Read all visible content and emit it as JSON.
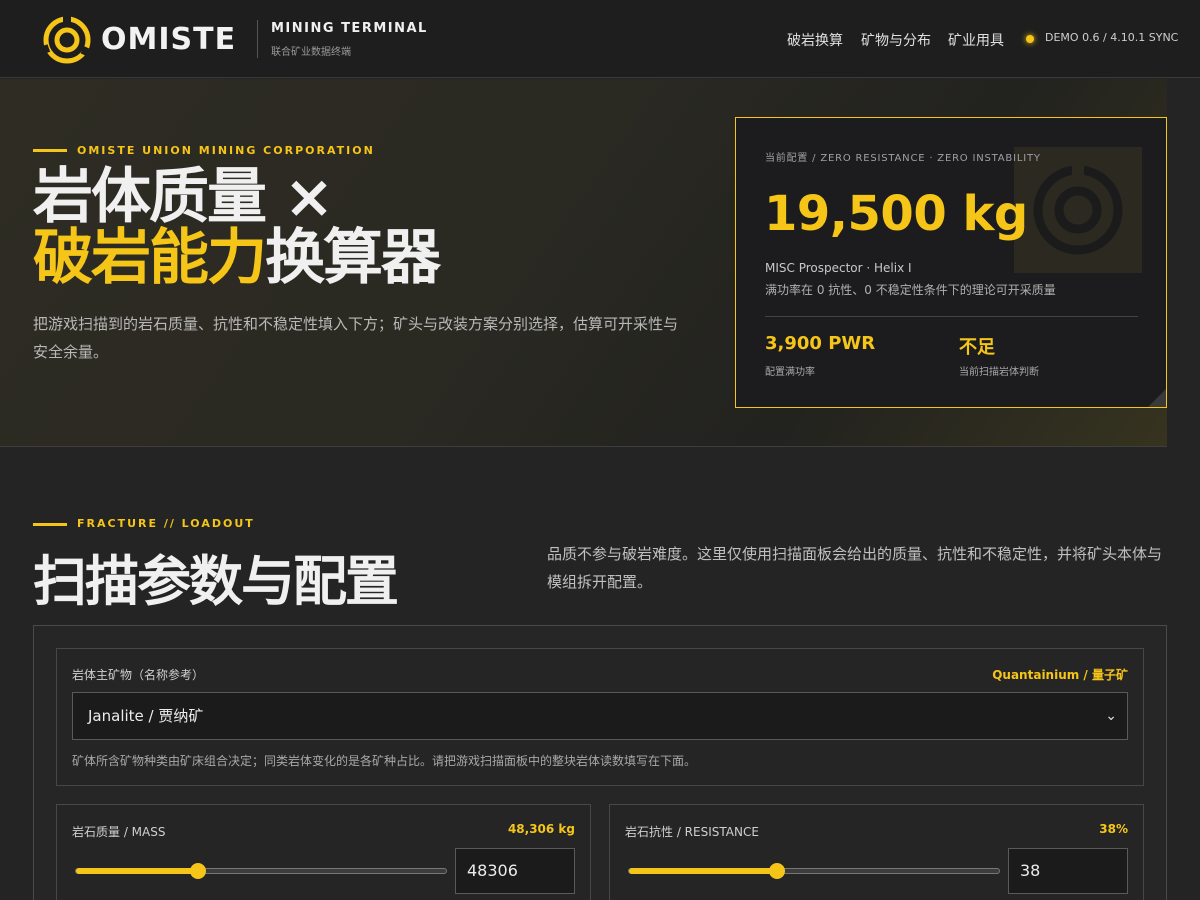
{
  "header": {
    "brand": "OMISTE",
    "subtitle": "MINING TERMINAL",
    "subtitle_cn": "联合矿业数据终端",
    "nav": [
      "破岩换算",
      "矿物与分布",
      "矿业用具"
    ],
    "status": "DEMO 0.6 / 4.10.1 SYNC"
  },
  "hero": {
    "eyebrow": "OMISTE UNION MINING CORPORATION",
    "title_line1": "岩体质量 ×",
    "title_line2_accent": "破岩能力",
    "title_line2_rest": "换算器",
    "description": "把游戏扫描到的岩石质量、抗性和不稳定性填入下方；矿头与改装方案分别选择，估算可开采性与安全余量。"
  },
  "result_card": {
    "label": "当前配置 / ZERO RESISTANCE · ZERO INSTABILITY",
    "value": "19,500 kg",
    "ship": "MISC Prospector · Helix I",
    "note": "满功率在 0 抗性、0 不稳定性条件下的理论可开采质量",
    "stats": [
      {
        "value": "3,900 PWR",
        "label": "配置满功率"
      },
      {
        "value": "不足",
        "label": "当前扫描岩体判断"
      }
    ]
  },
  "section": {
    "eyebrow": "FRACTURE // LOADOUT",
    "title": "扫描参数与配置",
    "description": "品质不参与破岩难度。这里仅使用扫描面板会给出的质量、抗性和不稳定性，并将矿头本体与模组拆开配置。"
  },
  "form": {
    "mineral": {
      "label": "岩体主矿物（名称参考）",
      "badge": "Quantainium / 量子矿",
      "selected": "Janalite / 贾纳矿",
      "help": "矿体所含矿物种类由矿床组合决定；同类岩体变化的是各矿种占比。请把游戏扫描面板中的整块岩体读数填写在下面。"
    },
    "mass": {
      "label": "岩石质量 / MASS",
      "badge": "48,306 kg",
      "value": "48306",
      "slider_fraction": 0.33
    },
    "resistance": {
      "label": "岩石抗性 / RESISTANCE",
      "badge": "38%",
      "value": "38",
      "slider_fraction": 0.4
    }
  },
  "colors": {
    "accent": "#f5c518",
    "background": "#242424",
    "header": "#1e1e1e"
  },
  "icons": [
    "omiste-logo-icon",
    "chevron-down-icon",
    "status-dot-icon"
  ]
}
